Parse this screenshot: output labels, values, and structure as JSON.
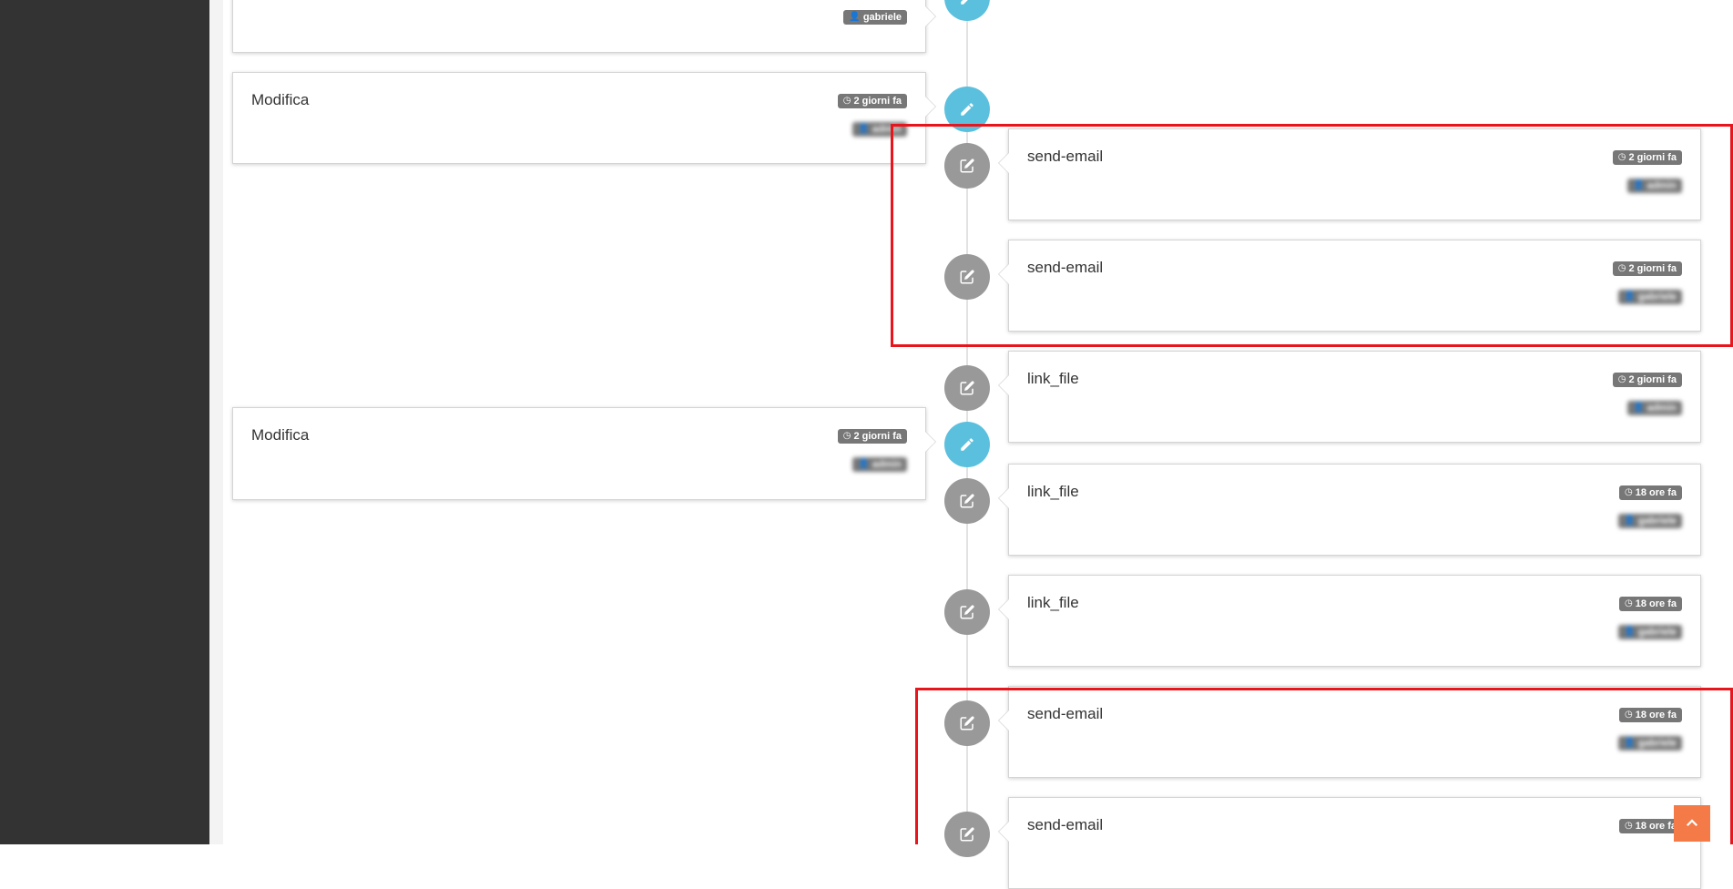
{
  "left_panels": [
    {
      "title": "",
      "time": "",
      "user": "gabriele"
    },
    {
      "title": "Modifica",
      "time": "2 giorni fa",
      "user": "admin"
    },
    {
      "title": "Modifica",
      "time": "2 giorni fa",
      "user": "admin"
    }
  ],
  "right_panels": [
    {
      "title": "send-email",
      "time": "2 giorni fa",
      "user": "admin"
    },
    {
      "title": "send-email",
      "time": "2 giorni fa",
      "user": "gabriele"
    },
    {
      "title": "link_file",
      "time": "2 giorni fa",
      "user": "admin"
    },
    {
      "title": "link_file",
      "time": "18 ore fa",
      "user": "gabriele"
    },
    {
      "title": "link_file",
      "time": "18 ore fa",
      "user": "gabriele"
    },
    {
      "title": "send-email",
      "time": "18 ore fa",
      "user": "gabriele"
    },
    {
      "title": "send-email",
      "time": "18 ore fa",
      "user": ""
    }
  ],
  "icons": {
    "edit_pencil": "pencil-icon",
    "edit_square": "edit-square-icon",
    "clock": "clock-icon",
    "user": "user-icon",
    "scroll_top": "chevron-up-icon"
  },
  "colors": {
    "sidebar": "#333333",
    "timeline_blue": "#5bc0de",
    "timeline_gray": "#999999",
    "badge": "#777777",
    "highlight": "#e8161c",
    "scroll_top": "#f47a47"
  }
}
